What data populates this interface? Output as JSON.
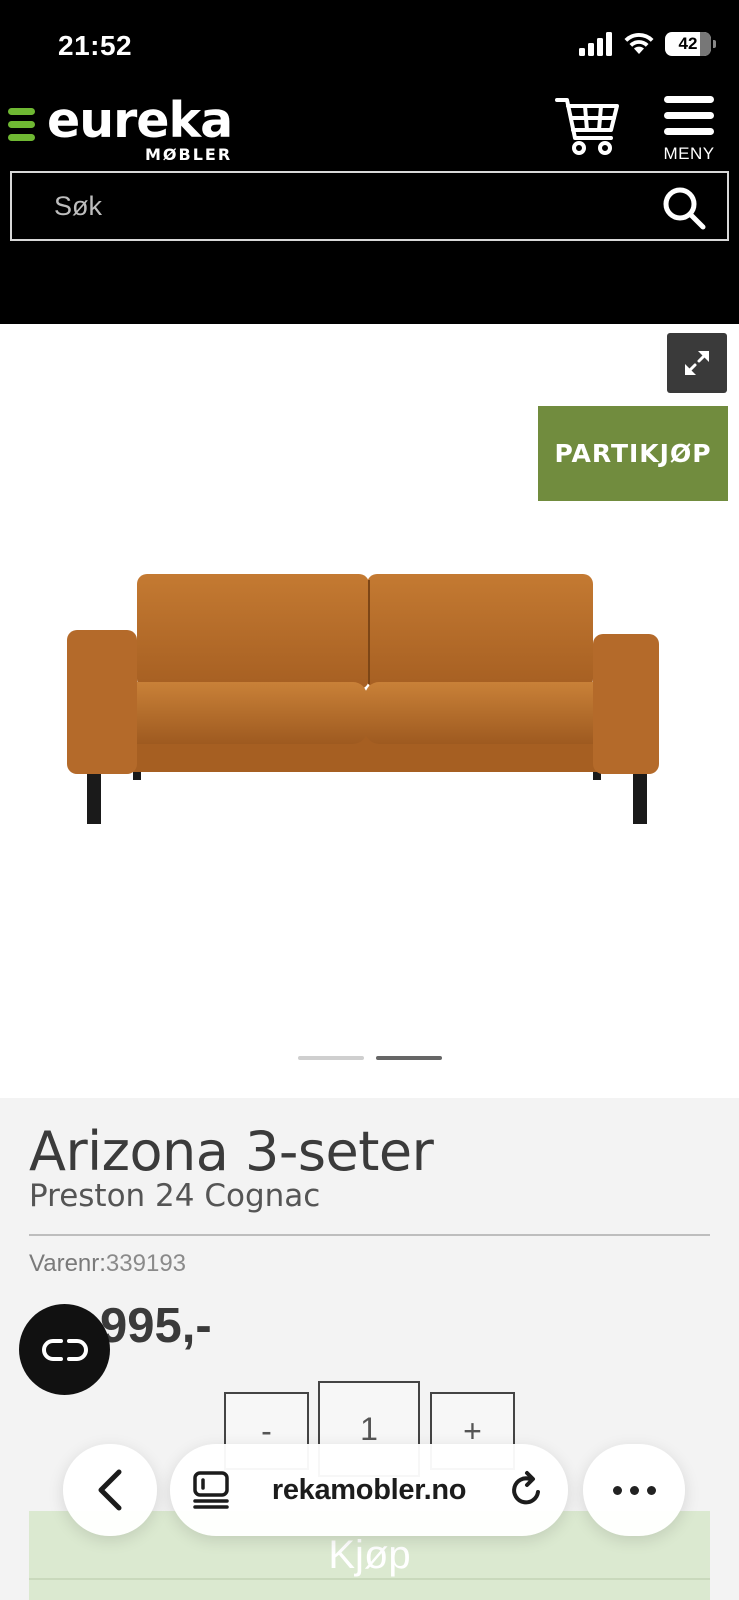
{
  "status_bar": {
    "time": "21:52",
    "battery": "42",
    "icons": [
      "signal-icon",
      "wifi-icon",
      "battery-icon"
    ]
  },
  "header": {
    "logo": {
      "word": "eureka",
      "sub": "MØBLER"
    },
    "menu_label": "MENY",
    "search": {
      "placeholder": "Søk",
      "value": ""
    },
    "colors": {
      "background": "#000000",
      "logo_accent": "#6fb833"
    }
  },
  "gallery": {
    "badge": "PARTIKJØP",
    "badge_color": "#718c3e",
    "slide_count": 2,
    "active_slide": 2,
    "image": "cognac-3-seat-sofa"
  },
  "product": {
    "title": "Arizona 3-seter",
    "subtitle": "Preston 24 Cognac",
    "sku_label": "Varenr:",
    "sku": "339193",
    "price": "995,-",
    "quantity": {
      "minus": "-",
      "value": "1",
      "plus": "+"
    },
    "buy_label": "Kjøp"
  },
  "browser": {
    "url": "rekamobler.no"
  }
}
